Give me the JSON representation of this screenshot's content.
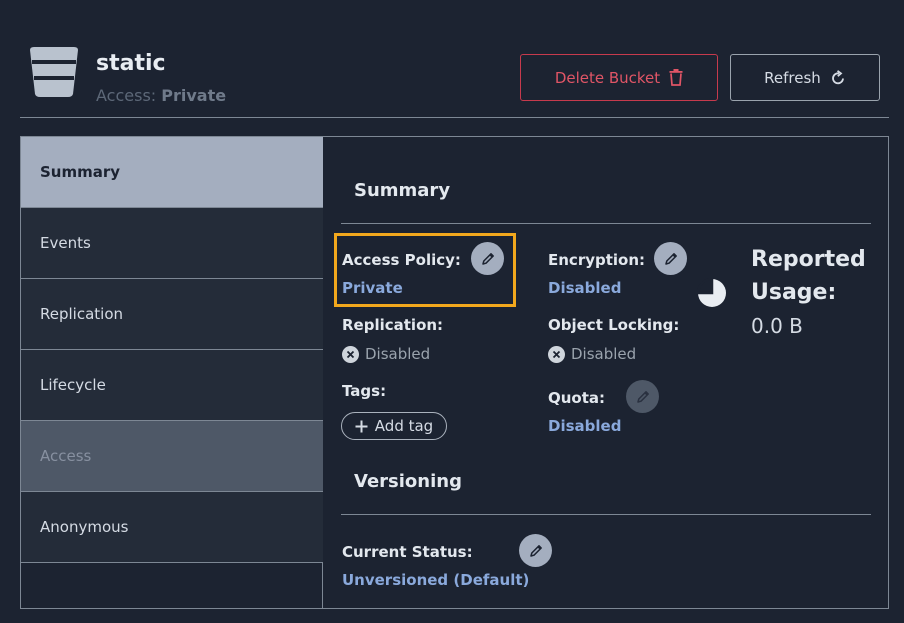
{
  "header": {
    "bucket_name": "static",
    "access_label": "Access:",
    "access_value": "Private",
    "delete_label": "Delete Bucket",
    "refresh_label": "Refresh",
    "colors": {
      "danger": "#e05566",
      "accent": "#8aa9dc",
      "highlight": "#f2a81d"
    }
  },
  "sidebar": {
    "tabs": [
      {
        "label": "Summary",
        "state": "active"
      },
      {
        "label": "Events",
        "state": "normal"
      },
      {
        "label": "Replication",
        "state": "normal"
      },
      {
        "label": "Lifecycle",
        "state": "normal"
      },
      {
        "label": "Access",
        "state": "disabled"
      },
      {
        "label": "Anonymous",
        "state": "normal"
      }
    ]
  },
  "summary": {
    "title": "Summary",
    "access_policy": {
      "label": "Access Policy:",
      "value": "Private"
    },
    "encryption": {
      "label": "Encryption:",
      "value": "Disabled"
    },
    "replication": {
      "label": "Replication:",
      "value": "Disabled"
    },
    "object_locking": {
      "label": "Object Locking:",
      "value": "Disabled"
    },
    "tags": {
      "label": "Tags:",
      "add_label": "Add tag"
    },
    "quota": {
      "label": "Quota:",
      "value": "Disabled"
    },
    "reported_usage": {
      "label": "Reported Usage:",
      "value": "0.0 B"
    }
  },
  "versioning": {
    "title": "Versioning",
    "current_status": {
      "label": "Current Status:",
      "value": "Unversioned (Default)"
    }
  },
  "icons": [
    "bucket-icon",
    "trash-icon",
    "refresh-icon",
    "edit-pencil-icon",
    "x-circle-icon",
    "plus-icon",
    "pie-chart-icon"
  ]
}
